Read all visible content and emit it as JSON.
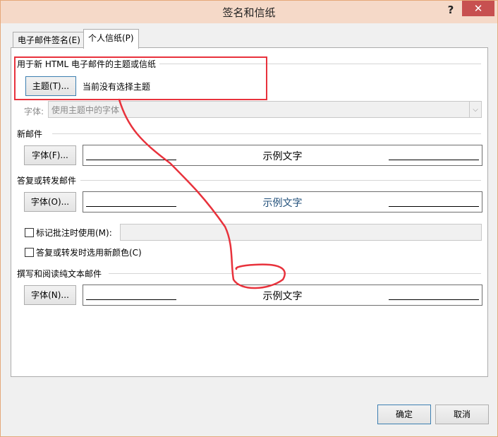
{
  "window": {
    "title": "签名和信纸",
    "help": "?",
    "close": "✕"
  },
  "tabs": [
    {
      "label": "电子邮件签名(E)"
    },
    {
      "label": "个人信纸(P)"
    }
  ],
  "theme_section": {
    "heading": "用于新 HTML 电子邮件的主题或信纸",
    "theme_button": "主题(T)...",
    "status": "当前没有选择主题",
    "font_label": "字体:",
    "font_value": "使用主题中的字体"
  },
  "new_mail": {
    "heading": "新邮件",
    "font_button": "字体(F)...",
    "sample": "示例文字"
  },
  "reply": {
    "heading": "答复或转发邮件",
    "font_button": "字体(O)...",
    "sample": "示例文字",
    "mark_comments_label": "标记批注时使用(M):",
    "pick_color_label": "答复或转发时选用新颜色(C)"
  },
  "plain_text": {
    "heading": "撰写和阅读纯文本邮件",
    "font_button": "字体(N)...",
    "sample": "示例文字"
  },
  "footer": {
    "ok": "确定",
    "cancel": "取消"
  },
  "colors": {
    "annotation": "#e8323c",
    "reply_sample_text": "#1f4e79"
  }
}
